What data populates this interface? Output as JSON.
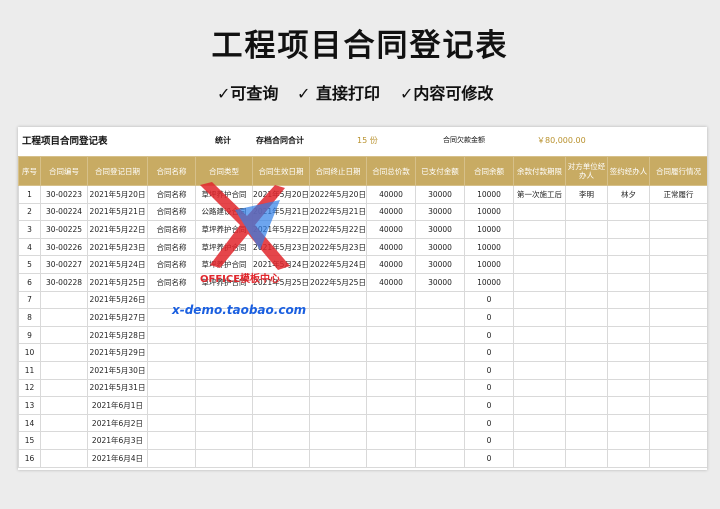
{
  "title": "工程项目合同登记表",
  "features": [
    "✓可查询",
    "✓ 直接打印",
    "✓内容可修改"
  ],
  "sheet": {
    "title": "工程项目合同登记表",
    "stat_label": "统计",
    "count_label": "存档合同合计",
    "count_value": "15 份",
    "debt_label": "合同欠款金额",
    "debt_value": "￥80,000.00"
  },
  "columns": [
    "序号",
    "合同编号",
    "合同登记日期",
    "合同名称",
    "合同类型",
    "合同生效日期",
    "合同终止日期",
    "合同总价款",
    "已支付金额",
    "合同余额",
    "余款付款期限",
    "对方单位经办人",
    "签约经办人",
    "合同履行情况"
  ],
  "rows": [
    [
      "1",
      "30-00223",
      "2021年5月20日",
      "合同名称",
      "草坪养护合同",
      "2021年5月20日",
      "2022年5月20日",
      "40000",
      "30000",
      "10000",
      "第一次施工后",
      "李明",
      "林夕",
      "正常履行"
    ],
    [
      "2",
      "30-00224",
      "2021年5月21日",
      "合同名称",
      "公路建设合同",
      "2021年5月21日",
      "2022年5月21日",
      "40000",
      "30000",
      "10000",
      "",
      "",
      "",
      ""
    ],
    [
      "3",
      "30-00225",
      "2021年5月22日",
      "合同名称",
      "草坪养护合同",
      "2021年5月22日",
      "2022年5月22日",
      "40000",
      "30000",
      "10000",
      "",
      "",
      "",
      ""
    ],
    [
      "4",
      "30-00226",
      "2021年5月23日",
      "合同名称",
      "草坪养护合同",
      "2021年5月23日",
      "2022年5月23日",
      "40000",
      "30000",
      "10000",
      "",
      "",
      "",
      ""
    ],
    [
      "5",
      "30-00227",
      "2021年5月24日",
      "合同名称",
      "草坪养护合同",
      "2021年5月24日",
      "2022年5月24日",
      "40000",
      "30000",
      "10000",
      "",
      "",
      "",
      ""
    ],
    [
      "6",
      "30-00228",
      "2021年5月25日",
      "合同名称",
      "草坪养护合同",
      "2021年5月25日",
      "2022年5月25日",
      "40000",
      "30000",
      "10000",
      "",
      "",
      "",
      ""
    ],
    [
      "7",
      "",
      "2021年5月26日",
      "",
      "",
      "",
      "",
      "",
      "",
      "0",
      "",
      "",
      "",
      ""
    ],
    [
      "8",
      "",
      "2021年5月27日",
      "",
      "",
      "",
      "",
      "",
      "",
      "0",
      "",
      "",
      "",
      ""
    ],
    [
      "9",
      "",
      "2021年5月28日",
      "",
      "",
      "",
      "",
      "",
      "",
      "0",
      "",
      "",
      "",
      ""
    ],
    [
      "10",
      "",
      "2021年5月29日",
      "",
      "",
      "",
      "",
      "",
      "",
      "0",
      "",
      "",
      "",
      ""
    ],
    [
      "11",
      "",
      "2021年5月30日",
      "",
      "",
      "",
      "",
      "",
      "",
      "0",
      "",
      "",
      "",
      ""
    ],
    [
      "12",
      "",
      "2021年5月31日",
      "",
      "",
      "",
      "",
      "",
      "",
      "0",
      "",
      "",
      "",
      ""
    ],
    [
      "13",
      "",
      "2021年6月1日",
      "",
      "",
      "",
      "",
      "",
      "",
      "0",
      "",
      "",
      "",
      ""
    ],
    [
      "14",
      "",
      "2021年6月2日",
      "",
      "",
      "",
      "",
      "",
      "",
      "0",
      "",
      "",
      "",
      ""
    ],
    [
      "15",
      "",
      "2021年6月3日",
      "",
      "",
      "",
      "",
      "",
      "",
      "0",
      "",
      "",
      "",
      ""
    ],
    [
      "16",
      "",
      "2021年6月4日",
      "",
      "",
      "",
      "",
      "",
      "",
      "0",
      "",
      "",
      "",
      ""
    ]
  ],
  "watermark": {
    "brand": "OFFICE模板中心",
    "url": "x-demo.taobao.com"
  },
  "colors": {
    "header": "#c8ab63",
    "accent_gold": "#b9922f",
    "watermark_blue": "#1a5fe0",
    "watermark_red": "#e0262c"
  }
}
